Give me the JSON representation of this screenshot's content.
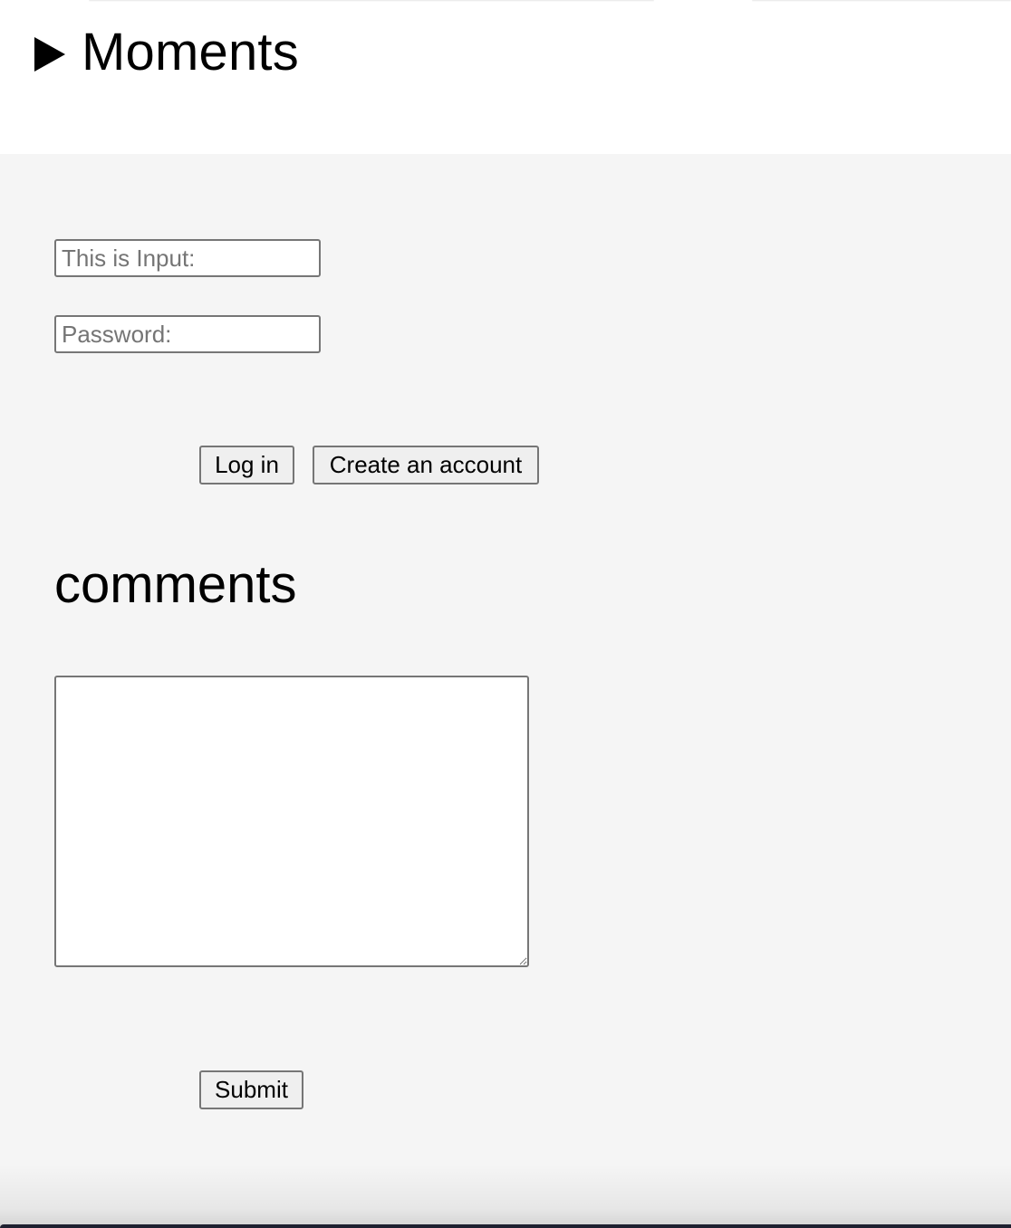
{
  "details": {
    "summary_title": "Moments",
    "summary_icon": "triangle-right-icon"
  },
  "login_form": {
    "username_placeholder": "This is Input:",
    "password_placeholder": "Password:",
    "login_label": "Log in",
    "create_account_label": "Create an account"
  },
  "comments": {
    "heading": "comments",
    "textarea_value": "",
    "submit_label": "Submit"
  },
  "colors": {
    "panel_background": "#f5f5f5",
    "header_background": "#ffffff",
    "button_background": "#efefef",
    "border": "#767676"
  }
}
